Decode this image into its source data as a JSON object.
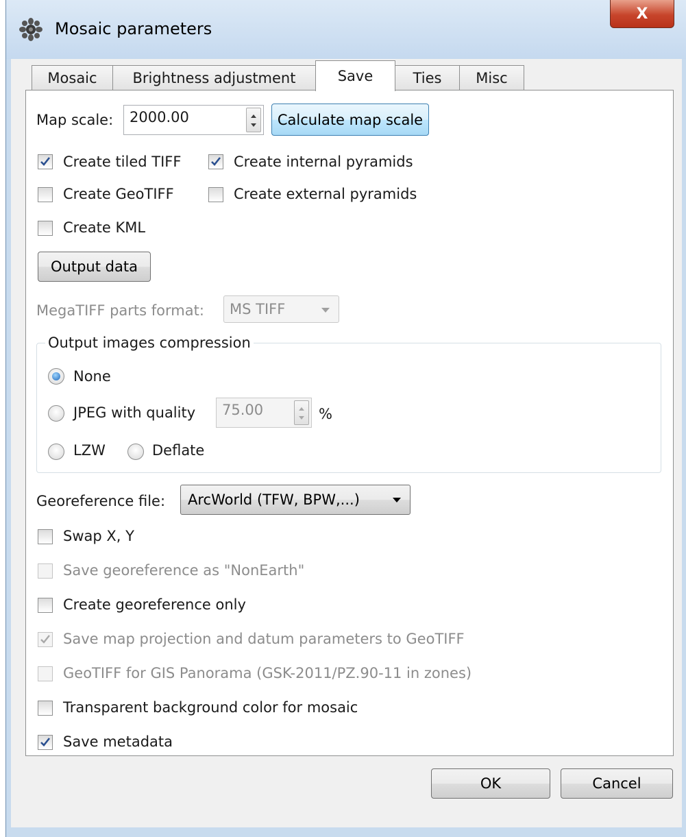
{
  "window": {
    "title": "Mosaic parameters",
    "close_label": "X"
  },
  "tabs": [
    {
      "label": "Mosaic",
      "active": false
    },
    {
      "label": "Brightness adjustment",
      "active": false
    },
    {
      "label": "Save",
      "active": true
    },
    {
      "label": "Ties",
      "active": false
    },
    {
      "label": "Misc",
      "active": false
    }
  ],
  "map_scale": {
    "label": "Map scale:",
    "value": "2000.00",
    "calculate_label": "Calculate map scale"
  },
  "checks_top": {
    "tiled_tiff": {
      "label": "Create tiled TIFF",
      "checked": true
    },
    "internal_pyramids": {
      "label": "Create internal pyramids",
      "checked": true
    },
    "geotiff": {
      "label": "Create GeoTIFF",
      "checked": false
    },
    "external_pyramids": {
      "label": "Create external pyramids",
      "checked": false
    },
    "kml": {
      "label": "Create KML",
      "checked": false
    }
  },
  "output_data_label": "Output data",
  "megatiff": {
    "label": "MegaTIFF parts format:",
    "value": "MS TIFF"
  },
  "compression": {
    "title": "Output images compression",
    "none_label": "None",
    "jpeg_label": "JPEG with quality",
    "jpeg_value": "75.00",
    "percent": "%",
    "lzw_label": "LZW",
    "deflate_label": "Deflate",
    "selected": "None"
  },
  "georef": {
    "label": "Georeference file:",
    "value": "ArcWorld (TFW, BPW,...)"
  },
  "checks_bottom": {
    "swap": {
      "label": "Swap X, Y",
      "checked": false,
      "enabled": true
    },
    "nonearth": {
      "label": "Save georeference as \"NonEarth\"",
      "checked": false,
      "enabled": false
    },
    "georef_only": {
      "label": "Create georeference only",
      "checked": false,
      "enabled": true
    },
    "projection": {
      "label": "Save map projection and datum parameters to GeoTIFF",
      "checked": true,
      "enabled": false
    },
    "panorama": {
      "label": "GeoTIFF for GIS Panorama (GSK-2011/PZ.90-11 in zones)",
      "checked": false,
      "enabled": false
    },
    "transparent": {
      "label": "Transparent background color for mosaic",
      "checked": false,
      "enabled": true
    },
    "metadata": {
      "label": "Save metadata",
      "checked": true,
      "enabled": true
    }
  },
  "buttons": {
    "ok": "OK",
    "cancel": "Cancel"
  }
}
